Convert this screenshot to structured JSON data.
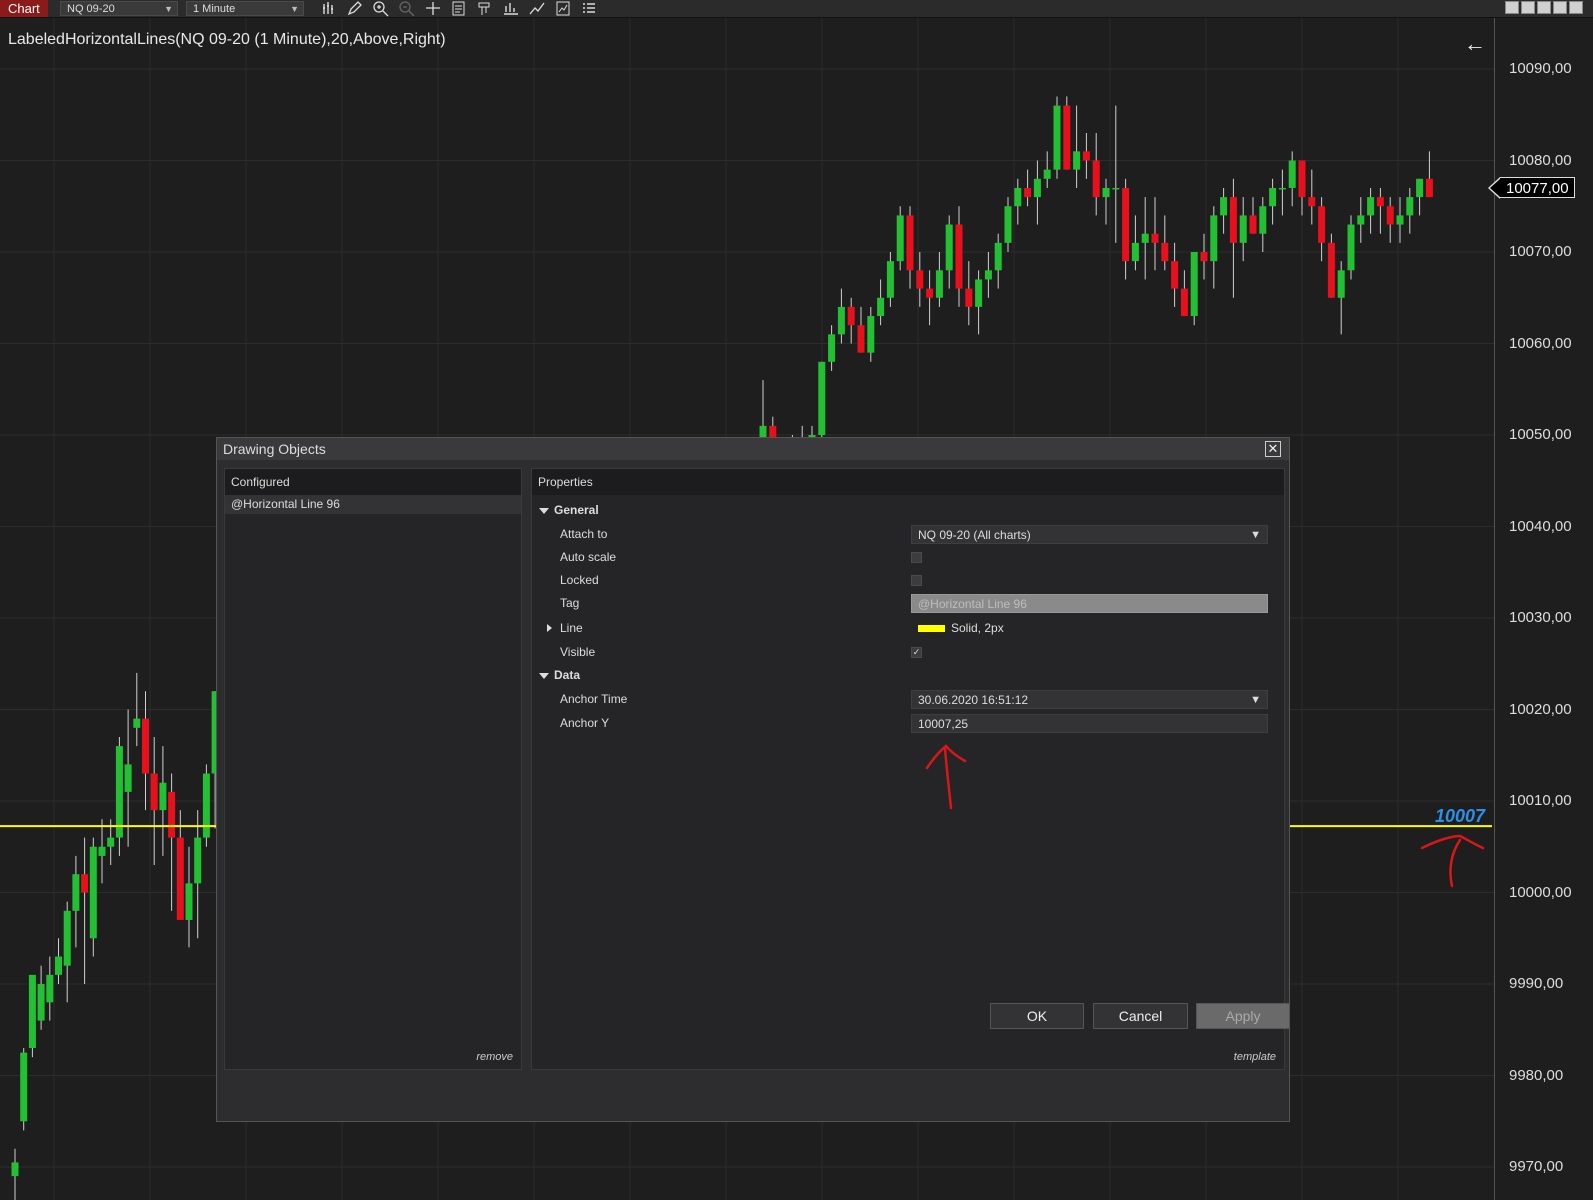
{
  "toolbar": {
    "chart_tab": "Chart",
    "instrument": "NQ 09-20",
    "interval": "1 Minute"
  },
  "chart": {
    "title": "LabeledHorizontalLines(NQ 09-20 (1 Minute),20,Above,Right)",
    "last_price": "10077,00",
    "line_label": "10007",
    "price_ticks": [
      "10090,00",
      "10080,00",
      "10070,00",
      "10060,00",
      "10050,00",
      "10040,00",
      "10030,00",
      "10020,00",
      "10010,00",
      "10000,00",
      "9990,00",
      "9980,00",
      "9970,00"
    ]
  },
  "chart_data": {
    "type": "candlestick",
    "y_axis_ticks": [
      10090,
      10080,
      10070,
      10060,
      10050,
      10040,
      10030,
      10020,
      10010,
      10000,
      9990,
      9980,
      9970
    ],
    "ylim": [
      9966.5,
      10091.5
    ],
    "last_price": 10077.0,
    "horizontal_line": 10007.25,
    "candles_left": [
      [
        9969,
        9972,
        9965,
        9970.5
      ],
      [
        9975,
        9983,
        9974,
        9982.5
      ],
      [
        9983,
        9990,
        9982,
        9991
      ],
      [
        9986,
        9992,
        9985,
        9990
      ],
      [
        9988,
        9993,
        9986,
        9991
      ],
      [
        9991,
        9995,
        9990,
        9993
      ],
      [
        9992,
        9999,
        9988,
        9998
      ],
      [
        9998,
        10004,
        9994,
        10002
      ],
      [
        10002,
        10006,
        9990,
        10000
      ],
      [
        9995,
        10006,
        9993,
        10005
      ],
      [
        10004,
        10008,
        10001,
        10005
      ],
      [
        10005,
        10008,
        10003,
        10006
      ],
      [
        10006,
        10017,
        10004,
        10016
      ],
      [
        10011,
        10020,
        10005,
        10014
      ],
      [
        10018,
        10024,
        10016,
        10019
      ],
      [
        10019,
        10022,
        10009,
        10013
      ],
      [
        10013,
        10017,
        10003,
        10009
      ],
      [
        10009,
        10016,
        10004,
        10012
      ],
      [
        10011,
        10013,
        9998,
        10006
      ],
      [
        10006,
        10009,
        10001,
        9997
      ],
      [
        9997,
        10005,
        9994,
        10001
      ],
      [
        10001,
        10009,
        9995,
        10006
      ],
      [
        10006,
        10014,
        10005,
        10013
      ],
      [
        10013,
        10022,
        10007,
        10022
      ]
    ],
    "candles_right": [
      [
        10048,
        10056,
        10046,
        10051
      ],
      [
        10051,
        10052,
        10045,
        10047
      ],
      [
        10047,
        10049,
        10046,
        10046.5
      ],
      [
        10046.5,
        10050,
        10046,
        10049
      ],
      [
        10049,
        10051,
        10046,
        10047
      ],
      [
        10047,
        10051,
        10044,
        10050
      ],
      [
        10050,
        10058,
        10049,
        10058
      ],
      [
        10058,
        10062,
        10057,
        10061
      ],
      [
        10061,
        10066,
        10060,
        10064
      ],
      [
        10064,
        10065,
        10060,
        10062
      ],
      [
        10062,
        10064,
        10059,
        10059
      ],
      [
        10059,
        10064,
        10058,
        10063
      ],
      [
        10063,
        10067,
        10062,
        10065
      ],
      [
        10065,
        10070,
        10064,
        10069
      ],
      [
        10069,
        10075,
        10068,
        10074
      ],
      [
        10074,
        10075,
        10066,
        10068
      ],
      [
        10068,
        10070,
        10064,
        10066
      ],
      [
        10066,
        10068,
        10062,
        10065
      ],
      [
        10065,
        10070,
        10064,
        10068
      ],
      [
        10068,
        10074,
        10066,
        10073
      ],
      [
        10073,
        10075,
        10064,
        10066
      ],
      [
        10066,
        10069,
        10062,
        10064
      ],
      [
        10064,
        10068,
        10061,
        10067
      ],
      [
        10067,
        10070,
        10065,
        10068
      ],
      [
        10068,
        10072,
        10066,
        10071
      ],
      [
        10071,
        10076,
        10070,
        10075
      ],
      [
        10075,
        10078,
        10073,
        10077
      ],
      [
        10077,
        10079,
        10075,
        10076
      ],
      [
        10076,
        10080,
        10073,
        10078
      ],
      [
        10078,
        10081,
        10077,
        10079
      ],
      [
        10079,
        10087,
        10078,
        10086
      ],
      [
        10086,
        10087,
        10079,
        10079
      ],
      [
        10079,
        10086,
        10077,
        10081
      ],
      [
        10081,
        10083,
        10078,
        10080
      ],
      [
        10080,
        10083,
        10074,
        10076
      ],
      [
        10076,
        10078,
        10073,
        10077
      ],
      [
        10077,
        10086,
        10071,
        10077
      ],
      [
        10077,
        10078,
        10067,
        10069
      ],
      [
        10069,
        10074,
        10068,
        10071
      ],
      [
        10071,
        10076,
        10067,
        10072
      ],
      [
        10072,
        10076,
        10068,
        10071
      ],
      [
        10071,
        10074,
        10068,
        10069
      ],
      [
        10069,
        10071,
        10064,
        10066
      ],
      [
        10066,
        10068,
        10063,
        10063
      ],
      [
        10063,
        10070,
        10062,
        10070
      ],
      [
        10070,
        10072,
        10067,
        10069
      ],
      [
        10069,
        10075,
        10066,
        10074
      ],
      [
        10074,
        10077,
        10072,
        10076
      ],
      [
        10076,
        10078,
        10065,
        10071
      ],
      [
        10071,
        10076,
        10069,
        10074
      ],
      [
        10074,
        10076,
        10072,
        10072
      ],
      [
        10072,
        10076,
        10070,
        10075
      ],
      [
        10075,
        10078,
        10073,
        10077
      ],
      [
        10077,
        10079,
        10074,
        10077
      ],
      [
        10077,
        10081,
        10075,
        10080
      ],
      [
        10080,
        10080,
        10074,
        10076
      ],
      [
        10076,
        10079,
        10073,
        10075
      ],
      [
        10075,
        10076,
        10069,
        10071
      ],
      [
        10071,
        10072,
        10065,
        10065
      ],
      [
        10065,
        10069,
        10061,
        10068
      ],
      [
        10068,
        10074,
        10067,
        10073
      ],
      [
        10073,
        10076,
        10071,
        10074
      ],
      [
        10074,
        10077,
        10072,
        10076
      ],
      [
        10076,
        10077,
        10072,
        10075
      ],
      [
        10075,
        10076,
        10071,
        10073
      ],
      [
        10073,
        10076,
        10071,
        10074
      ],
      [
        10074,
        10077,
        10072,
        10076
      ],
      [
        10076,
        10078,
        10074,
        10078
      ],
      [
        10078,
        10081,
        10076,
        10076
      ]
    ]
  },
  "dialog": {
    "title": "Drawing Objects",
    "close": "✕",
    "configured_header": "Configured",
    "configured_item": "@Horizontal Line 96",
    "remove": "remove",
    "properties_header": "Properties",
    "template": "template",
    "general_group": "General",
    "attach_to_label": "Attach to",
    "attach_to_value": "NQ 09-20 (All charts)",
    "auto_scale_label": "Auto scale",
    "locked_label": "Locked",
    "tag_label": "Tag",
    "tag_value": "@Horizontal Line 96",
    "line_label": "Line",
    "line_value": "Solid, 2px",
    "line_color": "#ffff00",
    "visible_label": "Visible",
    "visible_check": "✓",
    "data_group": "Data",
    "anchor_time_label": "Anchor Time",
    "anchor_time_value": "30.06.2020 16:51:12",
    "anchor_y_label": "Anchor Y",
    "anchor_y_value": "10007,25",
    "ok": "OK",
    "cancel": "Cancel",
    "apply": "Apply"
  },
  "icons": {
    "dropdown": "▼",
    "back_arrow": "←"
  },
  "colors": {
    "up_candle": "#22c032",
    "down_candle": "#e8101c",
    "horizontal_line": "#ffff00",
    "line_label": "#2e8fe8",
    "annotation": "#d81818"
  }
}
